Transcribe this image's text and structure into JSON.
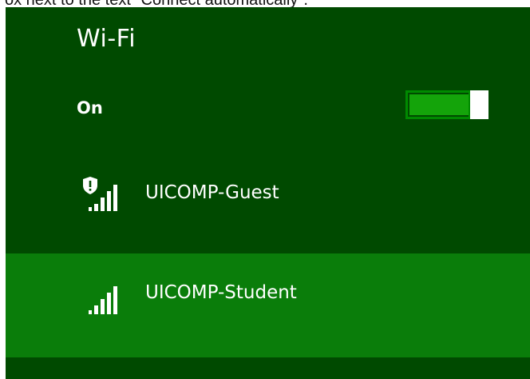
{
  "caption_clip": "ox next to the text \"Connect automatically\".",
  "wifi": {
    "title": "Wi-Fi",
    "status_label": "On",
    "toggle_on": true
  },
  "networks": [
    {
      "name": "UICOMP-Guest",
      "secured": false,
      "warning_shield": true,
      "signal_bars": 4,
      "selected": false,
      "icon": "wifi-signal-shield-warning-icon"
    },
    {
      "name": "UICOMP-Student",
      "secured": false,
      "warning_shield": false,
      "signal_bars": 4,
      "selected": true,
      "icon": "wifi-signal-icon"
    }
  ],
  "colors": {
    "panel_bg": "#004a00",
    "selected_bg": "#0a7d0a",
    "toggle_fill": "#14a40a",
    "toggle_border": "#008a00",
    "text": "#ffffff"
  }
}
